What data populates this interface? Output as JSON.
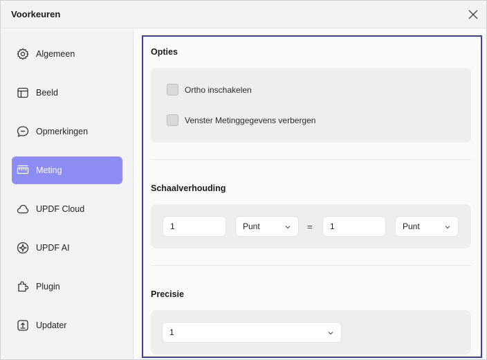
{
  "window": {
    "title": "Voorkeuren"
  },
  "sidebar": {
    "items": [
      {
        "label": "Algemeen",
        "icon": "gear-icon"
      },
      {
        "label": "Beeld",
        "icon": "layout-icon"
      },
      {
        "label": "Opmerkingen",
        "icon": "comment-icon"
      },
      {
        "label": "Meting",
        "icon": "ruler-icon",
        "active": true
      },
      {
        "label": "UPDF Cloud",
        "icon": "cloud-icon"
      },
      {
        "label": "UPDF AI",
        "icon": "ai-sparkle-icon"
      },
      {
        "label": "Plugin",
        "icon": "puzzle-icon"
      },
      {
        "label": "Updater",
        "icon": "update-icon"
      }
    ]
  },
  "options": {
    "title": "Opties",
    "ortho_label": "Ortho inschakelen",
    "hide_window_label": "Venster Metinggegevens verbergen"
  },
  "scale": {
    "title": "Schaalverhouding",
    "left_value": "1",
    "left_unit": "Punt",
    "equals": "=",
    "right_value": "1",
    "right_unit": "Punt"
  },
  "precision": {
    "title": "Precisie",
    "value": "1"
  },
  "colors": {
    "accent": "#8c8cf2",
    "focus_frame": "#3a3fa2"
  }
}
